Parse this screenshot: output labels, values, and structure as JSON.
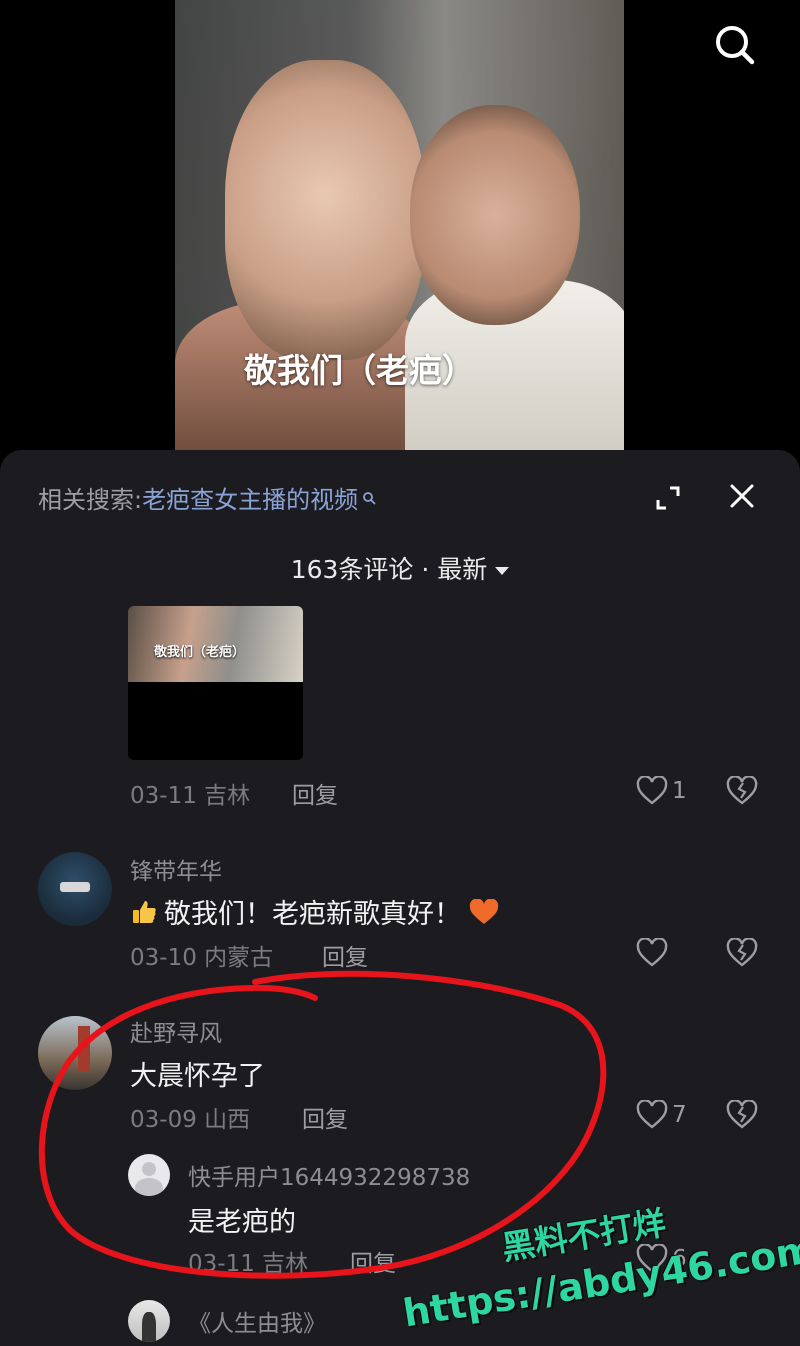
{
  "video": {
    "caption": "敬我们（老疤）",
    "search_icon": "search-icon"
  },
  "comments_panel": {
    "related_label": "相关搜索:",
    "related_query": "老疤查女主播的视频",
    "count_label": "163条评论 · 最新",
    "icons": [
      "expand-icon",
      "close-icon"
    ]
  },
  "comments": [
    {
      "thumbnail_caption": "敬我们（老疤）",
      "date": "03-11",
      "location": "吉林",
      "reply_label": "回复",
      "likes": "1"
    },
    {
      "username": "锋带年华",
      "text": "敬我们！老疤新歌真好！",
      "date": "03-10",
      "location": "内蒙古",
      "reply_label": "回复",
      "likes": ""
    },
    {
      "username": "赴野寻风",
      "text": "大晨怀孕了",
      "date": "03-09",
      "location": "山西",
      "reply_label": "回复",
      "likes": "7",
      "replies": [
        {
          "username": "快手用户1644932298738",
          "text": "是老疤的",
          "date": "03-11",
          "location": "吉林",
          "reply_label": "回复",
          "likes": "6"
        }
      ]
    },
    {
      "username": "《人生由我》"
    }
  ],
  "watermark": {
    "line1": "黑料不打烊",
    "line2": "https://abdy46.com",
    "color": "#2ed6a1"
  },
  "annotation": {
    "color": "#e8141b"
  }
}
